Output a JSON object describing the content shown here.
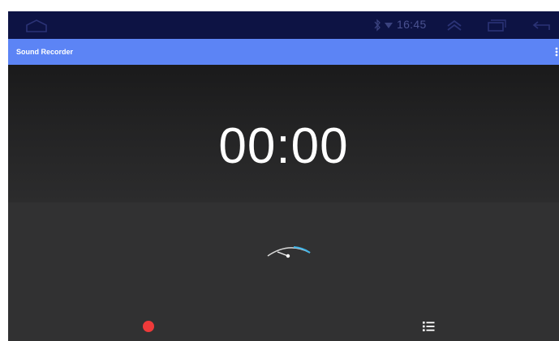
{
  "status_bar": {
    "time": "16:45",
    "icons": [
      "home-icon",
      "bluetooth-icon",
      "wifi-icon",
      "chevron-up-icon",
      "recent-apps-icon",
      "back-icon"
    ]
  },
  "action_bar": {
    "title": "Sound Recorder",
    "overflow_icon": "overflow-menu-icon"
  },
  "timer": {
    "display": "00:00"
  },
  "controls": {
    "record_icon": "record-icon",
    "recordings_list_icon": "list-icon",
    "level_meter_icon": "level-meter-icon"
  },
  "colors": {
    "status_bar": "#0d1344",
    "action_bar": "#5c84f5",
    "record": "#ee3a3a",
    "meter_accent": "#3fb4e8"
  }
}
